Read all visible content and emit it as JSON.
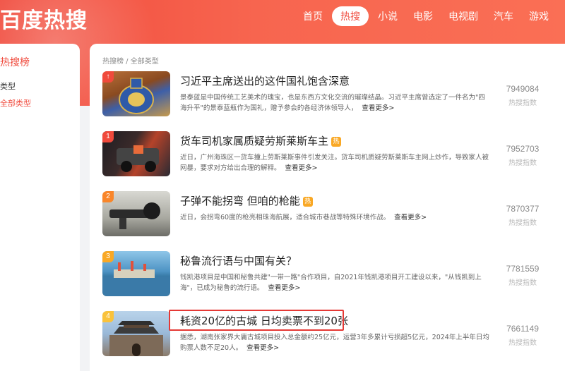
{
  "brand": {
    "logo": "百度热搜"
  },
  "nav": [
    "首页",
    "热搜",
    "小说",
    "电影",
    "电视剧",
    "汽车",
    "游戏"
  ],
  "nav_active": "热搜",
  "sidebar": {
    "title": "热搜榜",
    "type_label": "类型",
    "all_label": "全部类型"
  },
  "breadcrumb": "热搜榜 / 全部类型",
  "more_label": "查看更多>",
  "score_label": "热搜指数",
  "items": [
    {
      "rank": "",
      "title": "习近平主席送出的这件国礼饱含深意",
      "hot": false,
      "desc": "景泰蓝是中国传统工艺美术的瑰宝，也是东西方文化交流的璀璨结晶。习近平主席曾选定了一件名为\"四海升平\"的景泰蓝瓶作为国礼，赠予参会的各经济体领导人，",
      "score": "7949084"
    },
    {
      "rank": "1",
      "title": "货车司机家属质疑劳斯莱斯车主",
      "hot": true,
      "desc": "近日，广州海珠区一货车撞上劳斯莱斯事件引发关注。货车司机质疑劳斯莱斯车主网上炒作，导致家人被网暴，要求对方给出合理的解释。",
      "score": "7952703"
    },
    {
      "rank": "2",
      "title": "子弹不能拐弯 但咱的枪能",
      "hot": true,
      "desc": "近日，会拐弯60度的枪亮相珠海航展，适合城市巷战等特殊环境作战。",
      "score": "7870377"
    },
    {
      "rank": "3",
      "title": "秘鲁流行语与中国有关？",
      "hot": false,
      "desc": "钱凯港项目是中国和秘鲁共建\"一带一路\"合作项目，自2021年钱凯港项目开工建设以来，\"从钱凯到上海\"，已成为秘鲁的流行语。",
      "score": "7781559"
    },
    {
      "rank": "4",
      "title": "耗资20亿的古城 日均卖票不到20张",
      "hot": false,
      "desc": "据悉，湖南张家界大庸古城项目投入总金额约25亿元，运营3年多累计亏损超5亿元，2024年上半年日均购票人数不足20人。",
      "score": "7661149"
    }
  ],
  "colors": {
    "accent": "#f04a3c",
    "hot_tag": "#f9a825",
    "highlight": "#e53935"
  }
}
